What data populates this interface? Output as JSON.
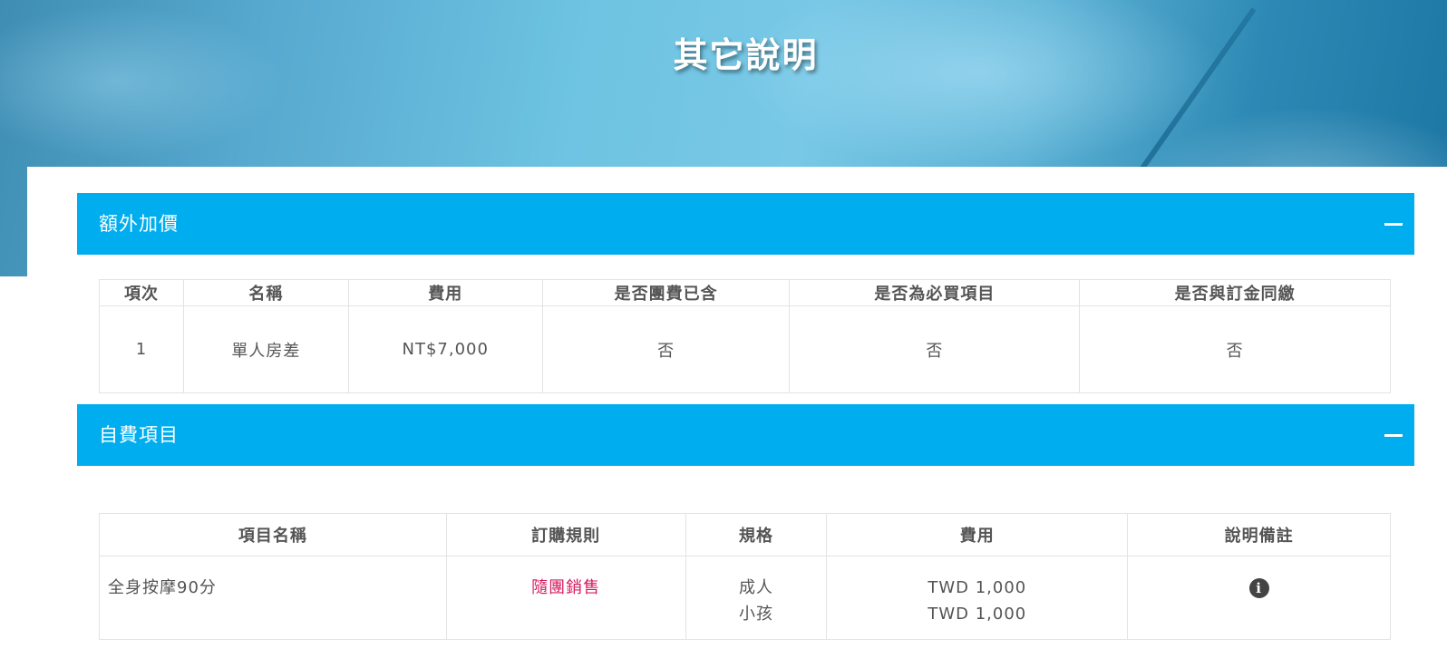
{
  "page_title": "其它說明",
  "extra_charges": {
    "title": "額外加價",
    "headers": [
      "項次",
      "名稱",
      "費用",
      "是否團費已含",
      "是否為必買項目",
      "是否與訂金同繳"
    ],
    "rows": [
      {
        "index": "1",
        "name": "單人房差",
        "fee": "NT$7,000",
        "included": "否",
        "required": "否",
        "with_deposit": "否"
      }
    ]
  },
  "optional_items": {
    "title": "自費項目",
    "headers": [
      "項目名稱",
      "訂購規則",
      "規格",
      "費用",
      "說明備註"
    ],
    "rows": [
      {
        "name": "全身按摩90分",
        "rule": "隨團銷售",
        "spec_1": "成人",
        "spec_2": "小孩",
        "fee_1": "TWD 1,000",
        "fee_2": "TWD 1,000",
        "note_icon": "info-circle-icon"
      }
    ]
  },
  "colors": {
    "section_bar": "#00adef",
    "rule_text": "#d81b60"
  }
}
